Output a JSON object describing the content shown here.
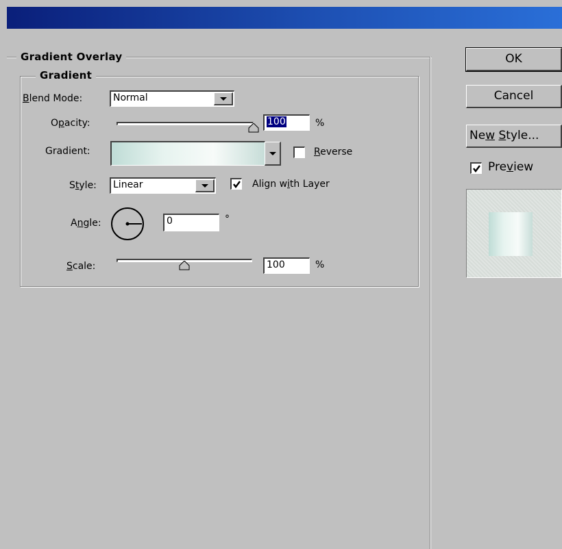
{
  "panel": {
    "outer_title": "Gradient Overlay",
    "inner_title": "Gradient"
  },
  "blend_mode": {
    "label_prefix": "",
    "label_mnemonic": "B",
    "label_rest": "lend Mode:",
    "value": "Normal"
  },
  "opacity": {
    "label_start": "O",
    "label_mnemonic": "p",
    "label_rest": "acity:",
    "value": "100",
    "unit": "%",
    "level": 1.0
  },
  "gradient": {
    "label": "Gradient:",
    "colors": [
      "#bfdcd6",
      "#e6f3ef",
      "#f7fbf9",
      "#c7ddd8"
    ],
    "reverse_mnemonic": "R",
    "reverse_rest": "everse",
    "reverse_checked": false
  },
  "style": {
    "label_start": "S",
    "label_mnemonic": "t",
    "label_rest": "yle:",
    "value": "Linear",
    "align_start": "Align w",
    "align_mnemonic": "i",
    "align_rest": "th Layer",
    "align_checked": true
  },
  "angle": {
    "label_start": "A",
    "label_mnemonic": "n",
    "label_rest": "gle:",
    "value": "0",
    "unit": "°"
  },
  "scale": {
    "label_mnemonic": "S",
    "label_rest": "cale:",
    "value": "100",
    "unit": "%",
    "level": 0.5
  },
  "buttons": {
    "ok": "OK",
    "cancel": "Cancel",
    "new_style_start": "Ne",
    "new_style_mnemonic": "w",
    "new_style_mid": " ",
    "new_style_mnemonic2": "S",
    "new_style_rest": "tyle..."
  },
  "preview": {
    "label_start": "Pre",
    "label_mnemonic": "v",
    "label_rest": "iew",
    "checked": true
  },
  "colors": {
    "dialog_bg": "#c0c0c0",
    "titlebar_start": "#0a1f7a",
    "titlebar_end": "#2a6fd8",
    "selection": "#000080"
  }
}
